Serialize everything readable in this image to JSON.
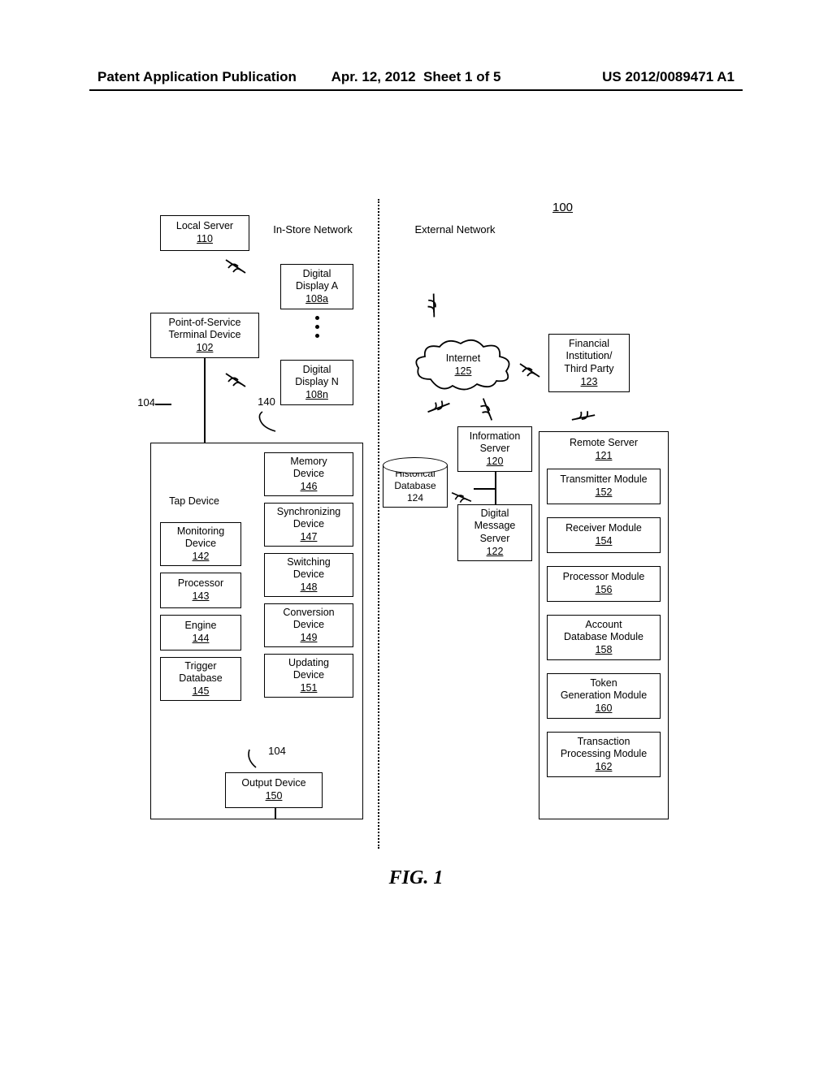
{
  "header": {
    "left": "Patent Application Publication",
    "date": "Apr. 12, 2012",
    "sheet": "Sheet 1 of 5",
    "pubno": "US 2012/0089471 A1"
  },
  "figure_ref": "100",
  "network_labels": {
    "in_store": "In-Store Network",
    "external": "External Network"
  },
  "ref_numbers": {
    "lbl_104_left": "104",
    "lbl_140": "140",
    "lbl_104_arc": "104"
  },
  "boxes": {
    "local_server": {
      "l1": "Local Server",
      "ref": "110"
    },
    "display_a": {
      "l1": "Digital",
      "l2": "Display A",
      "ref": "108a"
    },
    "display_n": {
      "l1": "Digital",
      "l2": "Display N",
      "ref": "108n"
    },
    "pos": {
      "l1": "Point-of-Service",
      "l2": "Terminal Device",
      "ref": "102"
    },
    "tap": {
      "l1": "Tap Device"
    },
    "monitoring": {
      "l1": "Monitoring",
      "l2": "Device",
      "ref": "142"
    },
    "processor": {
      "l1": "Processor",
      "ref": "143"
    },
    "engine": {
      "l1": "Engine",
      "ref": "144"
    },
    "trigger_db": {
      "l1": "Trigger",
      "l2": "Database",
      "ref": "145"
    },
    "memory": {
      "l1": "Memory",
      "l2": "Device",
      "ref": "146"
    },
    "sync": {
      "l1": "Synchronizing",
      "l2": "Device",
      "ref": "147"
    },
    "switching": {
      "l1": "Switching",
      "l2": "Device",
      "ref": "148"
    },
    "conversion": {
      "l1": "Conversion",
      "l2": "Device",
      "ref": "149"
    },
    "output": {
      "l1": "Output Device",
      "ref": "150"
    },
    "updating": {
      "l1": "Updating",
      "l2": "Device",
      "ref": "151"
    },
    "fin_inst": {
      "l1": "Financial",
      "l2": "Institution/",
      "l3": "Third Party",
      "ref": "123"
    },
    "remote_server": {
      "l1": "Remote Server",
      "ref": "121"
    },
    "transmitter": {
      "l1": "Transmitter Module",
      "ref": "152"
    },
    "receiver": {
      "l1": "Receiver Module",
      "ref": "154"
    },
    "proc_module": {
      "l1": "Processor Module",
      "ref": "156"
    },
    "acct_db": {
      "l1": "Account",
      "l2": "Database Module",
      "ref": "158"
    },
    "token": {
      "l1": "Token",
      "l2": "Generation Module",
      "ref": "160"
    },
    "txn": {
      "l1": "Transaction",
      "l2": "Processing Module",
      "ref": "162"
    },
    "info_server": {
      "l1": "Information",
      "l2": "Server",
      "ref": "120"
    },
    "msg_server": {
      "l1": "Digital",
      "l2": "Message",
      "l3": "Server",
      "ref": "122"
    },
    "internet": {
      "l1": "Internet",
      "ref": "125"
    },
    "hist_db": {
      "l1": "Historical",
      "l2": "Database",
      "ref": "124"
    }
  },
  "caption": "FIG. 1"
}
